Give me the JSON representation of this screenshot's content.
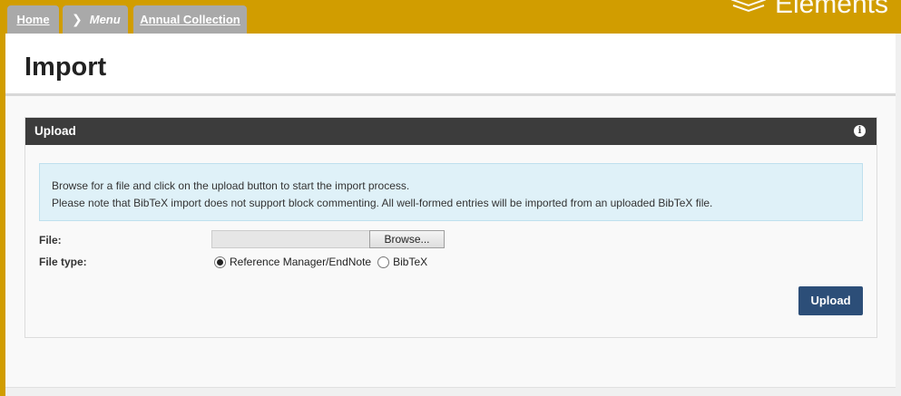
{
  "breadcrumbs": {
    "home": "Home",
    "menu": "Menu",
    "annual": "Annual Collection"
  },
  "brand": {
    "name": "Elements"
  },
  "page": {
    "title": "Import"
  },
  "panel": {
    "title": "Upload",
    "notice_line1": "Browse for a file and click on the upload button to start the import process.",
    "notice_line2": "Please note that BibTeX import does not support block commenting. All well-formed entries will be imported from an uploaded BibTeX file.",
    "file_label": "File:",
    "browse_label": "Browse...",
    "file_type_label": "File type:",
    "file_types": [
      {
        "label": "Reference Manager/EndNote",
        "selected": true
      },
      {
        "label": "BibTeX",
        "selected": false
      }
    ],
    "upload_label": "Upload"
  },
  "icons": {
    "menu_chevron": "chevron-right-icon",
    "info": "info-icon",
    "brand": "elements-logo-icon"
  },
  "colors": {
    "topbar": "#d19d00",
    "tab": "#a9a9a9",
    "panel_header": "#3c3c3c",
    "notice_bg": "#dff1f8",
    "upload_button": "#2c4e78"
  }
}
